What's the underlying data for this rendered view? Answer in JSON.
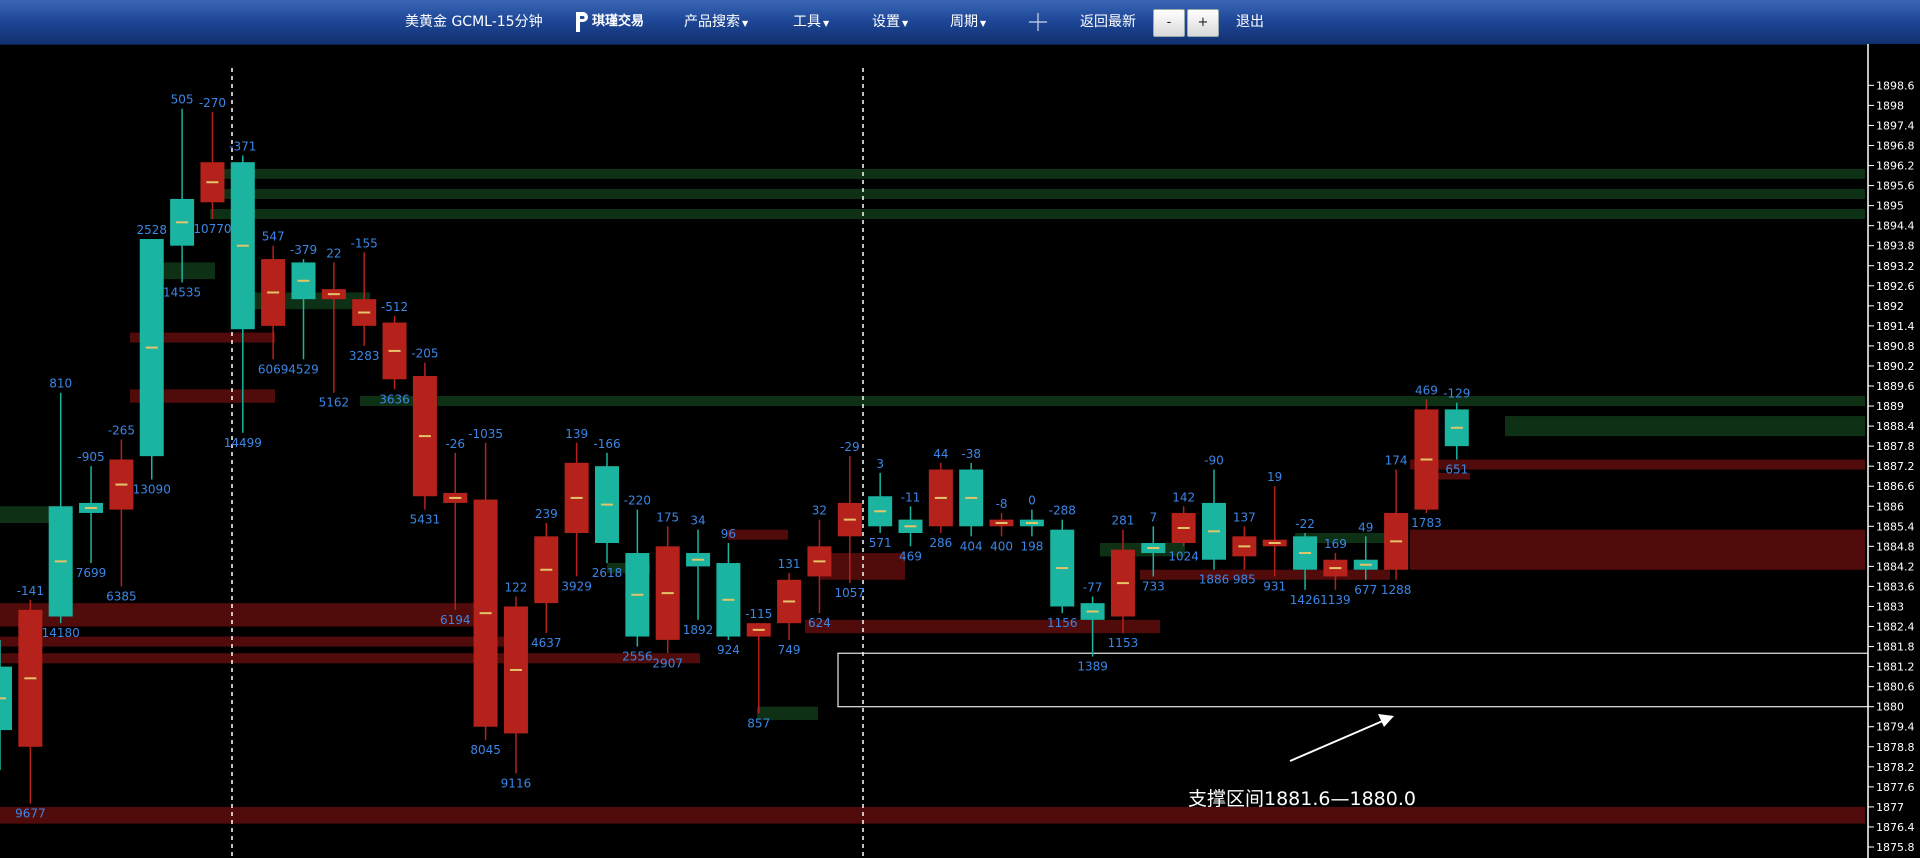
{
  "toolbar": {
    "title": "美黄金 GCML-15分钟",
    "logo_text": "琪瑾交易",
    "menus": [
      "产品搜索",
      "工具",
      "设置",
      "周期"
    ],
    "latest_label": "返回最新",
    "zoom_out": "-",
    "zoom_in": "+",
    "exit_label": "退出"
  },
  "chart_data": {
    "type": "candlestick",
    "y_range": [
      1875.8,
      1899.0
    ],
    "y_ticks": [
      1898.6,
      1898,
      1897.4,
      1896.8,
      1896.2,
      1895.6,
      1895,
      1894.4,
      1893.8,
      1893.2,
      1892.6,
      1892,
      1891.4,
      1890.8,
      1890.2,
      1889.6,
      1889,
      1888.4,
      1887.8,
      1887.2,
      1886.6,
      1886,
      1885.4,
      1884.8,
      1884.2,
      1883.6,
      1883,
      1882.4,
      1881.8,
      1881.2,
      1880.6,
      1880,
      1879.4,
      1878.8,
      1878.2,
      1877.6,
      1877,
      1876.4,
      1875.8
    ],
    "annotation": "支撑区间1881.6—1880.0",
    "support_zone": [
      1880.0,
      1881.6
    ],
    "colors": {
      "up": "#1ab4a0",
      "down": "#b5221c",
      "label": "#3a86e6",
      "avg": "#e3c46a"
    },
    "candles": [
      {
        "o": 1879.3,
        "h": 1882,
        "l": 1878.1,
        "c": 1881.2,
        "top": null,
        "bot": null
      },
      {
        "o": 1882.9,
        "h": 1883.2,
        "l": 1877.1,
        "c": 1878.8,
        "top": "-141",
        "bot": "9677"
      },
      {
        "o": 1882.7,
        "h": 1889.4,
        "l": 1882.5,
        "c": 1886.0,
        "top": "810",
        "bot": "14180"
      },
      {
        "o": 1885.8,
        "h": 1887.2,
        "l": 1884.3,
        "c": 1886.1,
        "top": "-905",
        "bot": "7699"
      },
      {
        "o": 1887.4,
        "h": 1888.0,
        "l": 1883.6,
        "c": 1885.9,
        "top": "-265",
        "bot": "6385"
      },
      {
        "o": 1887.5,
        "h": 1894.0,
        "l": 1886.8,
        "c": 1894.0,
        "top": "2528",
        "bot": "13090"
      },
      {
        "o": 1893.8,
        "h": 1897.9,
        "l": 1892.7,
        "c": 1895.2,
        "top": "505",
        "bot": "14535"
      },
      {
        "o": 1896.3,
        "h": 1897.8,
        "l": 1894.6,
        "c": 1895.1,
        "top": "-270",
        "bot": "10770"
      },
      {
        "o": 1891.3,
        "h": 1896.5,
        "l": 1888.2,
        "c": 1896.3,
        "top": "-371",
        "bot": "14499"
      },
      {
        "o": 1893.4,
        "h": 1893.8,
        "l": 1890.4,
        "c": 1891.4,
        "top": "547",
        "bot": "6069"
      },
      {
        "o": 1892.2,
        "h": 1893.4,
        "l": 1890.4,
        "c": 1893.3,
        "top": "-379",
        "bot": "4529"
      },
      {
        "o": 1892.5,
        "h": 1893.3,
        "l": 1889.4,
        "c": 1892.2,
        "top": "22",
        "bot": "5162"
      },
      {
        "o": 1892.2,
        "h": 1893.6,
        "l": 1890.8,
        "c": 1891.4,
        "top": "-155",
        "bot": "3283"
      },
      {
        "o": 1891.5,
        "h": 1891.7,
        "l": 1889.5,
        "c": 1889.8,
        "top": "-512",
        "bot": "3636"
      },
      {
        "o": 1889.9,
        "h": 1890.3,
        "l": 1885.9,
        "c": 1886.3,
        "top": "-205",
        "bot": "5431"
      },
      {
        "o": 1886.4,
        "h": 1887.6,
        "l": 1882.9,
        "c": 1886.1,
        "top": "-26",
        "bot": "6194"
      },
      {
        "o": 1886.2,
        "h": 1887.9,
        "l": 1879.0,
        "c": 1879.4,
        "top": "-1035",
        "bot": "8045"
      },
      {
        "o": 1883.0,
        "h": 1883.3,
        "l": 1878.0,
        "c": 1879.2,
        "top": "122",
        "bot": "9116"
      },
      {
        "o": 1885.1,
        "h": 1885.5,
        "l": 1882.2,
        "c": 1883.1,
        "top": "239",
        "bot": "4637"
      },
      {
        "o": 1887.3,
        "h": 1887.9,
        "l": 1883.9,
        "c": 1885.2,
        "top": "139",
        "bot": "3929"
      },
      {
        "o": 1884.9,
        "h": 1887.6,
        "l": 1884.3,
        "c": 1887.2,
        "top": "-166",
        "bot": "2618"
      },
      {
        "o": 1882.1,
        "h": 1885.9,
        "l": 1881.8,
        "c": 1884.6,
        "top": "-220",
        "bot": "2556"
      },
      {
        "o": 1884.8,
        "h": 1885.4,
        "l": 1881.6,
        "c": 1882.0,
        "top": "175",
        "bot": "2907"
      },
      {
        "o": 1884.2,
        "h": 1885.3,
        "l": 1882.6,
        "c": 1884.6,
        "top": "34",
        "bot": "1892"
      },
      {
        "o": 1882.1,
        "h": 1884.9,
        "l": 1882.0,
        "c": 1884.3,
        "top": "96",
        "bot": "924"
      },
      {
        "o": 1882.5,
        "h": 1882.5,
        "l": 1879.8,
        "c": 1882.1,
        "top": "-115",
        "bot": "857"
      },
      {
        "o": 1883.8,
        "h": 1884.0,
        "l": 1882.0,
        "c": 1882.5,
        "top": "131",
        "bot": "749"
      },
      {
        "o": 1884.8,
        "h": 1885.6,
        "l": 1882.8,
        "c": 1883.9,
        "top": "32",
        "bot": "624"
      },
      {
        "o": 1886.1,
        "h": 1887.5,
        "l": 1883.7,
        "c": 1885.1,
        "top": "-29",
        "bot": "1057"
      },
      {
        "o": 1885.4,
        "h": 1887.0,
        "l": 1885.2,
        "c": 1886.3,
        "top": "3",
        "bot": "571"
      },
      {
        "o": 1885.2,
        "h": 1886.0,
        "l": 1884.8,
        "c": 1885.6,
        "top": "-11",
        "bot": "469"
      },
      {
        "o": 1887.1,
        "h": 1887.3,
        "l": 1885.2,
        "c": 1885.4,
        "top": "44",
        "bot": "286"
      },
      {
        "o": 1885.4,
        "h": 1887.3,
        "l": 1885.1,
        "c": 1887.1,
        "top": "-38",
        "bot": "404"
      },
      {
        "o": 1885.6,
        "h": 1885.8,
        "l": 1885.1,
        "c": 1885.4,
        "top": "-8",
        "bot": "400"
      },
      {
        "o": 1885.4,
        "h": 1885.9,
        "l": 1885.1,
        "c": 1885.6,
        "top": "0",
        "bot": "198"
      },
      {
        "o": 1883.0,
        "h": 1885.6,
        "l": 1882.8,
        "c": 1885.3,
        "top": "-288",
        "bot": "1156"
      },
      {
        "o": 1882.6,
        "h": 1883.3,
        "l": 1881.5,
        "c": 1883.1,
        "top": "-77",
        "bot": "1389"
      },
      {
        "o": 1884.7,
        "h": 1885.3,
        "l": 1882.2,
        "c": 1882.7,
        "top": "281",
        "bot": "1153"
      },
      {
        "o": 1884.6,
        "h": 1885.4,
        "l": 1883.9,
        "c": 1884.9,
        "top": "7",
        "bot": "733"
      },
      {
        "o": 1885.8,
        "h": 1886.0,
        "l": 1884.8,
        "c": 1884.9,
        "top": "142",
        "bot": "1024"
      },
      {
        "o": 1884.4,
        "h": 1887.1,
        "l": 1884.1,
        "c": 1886.1,
        "top": "-90",
        "bot": "1886"
      },
      {
        "o": 1885.1,
        "h": 1885.4,
        "l": 1884.1,
        "c": 1884.5,
        "top": "137",
        "bot": "985"
      },
      {
        "o": 1885.0,
        "h": 1886.6,
        "l": 1883.9,
        "c": 1884.8,
        "top": "19",
        "bot": "931"
      },
      {
        "o": 1884.1,
        "h": 1885.2,
        "l": 1883.5,
        "c": 1885.1,
        "top": "-22",
        "bot": "1426"
      },
      {
        "o": 1884.4,
        "h": 1884.6,
        "l": 1883.5,
        "c": 1883.9,
        "top": "169",
        "bot": "1139"
      },
      {
        "o": 1884.1,
        "h": 1885.1,
        "l": 1883.8,
        "c": 1884.4,
        "top": "49",
        "bot": "677"
      },
      {
        "o": 1885.8,
        "h": 1887.1,
        "l": 1883.8,
        "c": 1884.1,
        "top": "174",
        "bot": "1288"
      },
      {
        "o": 1888.9,
        "h": 1889.2,
        "l": 1885.8,
        "c": 1885.9,
        "top": "469",
        "bot": "1783"
      },
      {
        "o": 1887.8,
        "h": 1889.1,
        "l": 1887.4,
        "c": 1888.9,
        "top": "-129",
        "bot": "651"
      }
    ],
    "zones": [
      {
        "y1": 1896.1,
        "y2": 1895.8,
        "x1": 210,
        "x2": 1865,
        "c": "g"
      },
      {
        "y1": 1895.5,
        "y2": 1895.2,
        "x1": 210,
        "x2": 1865,
        "c": "g"
      },
      {
        "y1": 1894.9,
        "y2": 1894.6,
        "x1": 210,
        "x2": 1865,
        "c": "g"
      },
      {
        "y1": 1889.3,
        "y2": 1889.0,
        "x1": 360,
        "x2": 1865,
        "c": "g"
      },
      {
        "y1": 1888.7,
        "y2": 1888.1,
        "x1": 1505,
        "x2": 1865,
        "c": "g"
      },
      {
        "y1": 1893.3,
        "y2": 1892.8,
        "x1": 158,
        "x2": 215,
        "c": "g"
      },
      {
        "y1": 1892.4,
        "y2": 1891.9,
        "x1": 250,
        "x2": 370,
        "c": "g"
      },
      {
        "y1": 1886.0,
        "y2": 1885.5,
        "x1": 0,
        "x2": 60,
        "c": "g"
      },
      {
        "y1": 1884.9,
        "y2": 1884.5,
        "x1": 1100,
        "x2": 1185,
        "c": "g"
      },
      {
        "y1": 1885.2,
        "y2": 1884.9,
        "x1": 1295,
        "x2": 1390,
        "c": "g"
      },
      {
        "y1": 1884.3,
        "y2": 1884.0,
        "x1": 607,
        "x2": 650,
        "c": "g"
      },
      {
        "y1": 1880.0,
        "y2": 1879.6,
        "x1": 757,
        "x2": 818,
        "c": "g"
      },
      {
        "y1": 1891.2,
        "y2": 1890.9,
        "x1": 130,
        "x2": 275,
        "c": "r"
      },
      {
        "y1": 1889.5,
        "y2": 1889.1,
        "x1": 130,
        "x2": 275,
        "c": "r"
      },
      {
        "y1": 1887.4,
        "y2": 1887.1,
        "x1": 1410,
        "x2": 1865,
        "c": "r"
      },
      {
        "y1": 1887.0,
        "y2": 1886.8,
        "x1": 1415,
        "x2": 1470,
        "c": "r"
      },
      {
        "y1": 1885.3,
        "y2": 1884.6,
        "x1": 1410,
        "x2": 1865,
        "c": "r"
      },
      {
        "y1": 1884.6,
        "y2": 1884.1,
        "x1": 1410,
        "x2": 1865,
        "c": "r"
      },
      {
        "y1": 1884.6,
        "y2": 1883.8,
        "x1": 820,
        "x2": 905,
        "c": "r"
      },
      {
        "y1": 1885.3,
        "y2": 1885.0,
        "x1": 728,
        "x2": 788,
        "c": "r"
      },
      {
        "y1": 1884.1,
        "y2": 1883.8,
        "x1": 1140,
        "x2": 1390,
        "c": "r"
      },
      {
        "y1": 1883.1,
        "y2": 1882.4,
        "x1": 0,
        "x2": 480,
        "c": "r"
      },
      {
        "y1": 1882.6,
        "y2": 1882.2,
        "x1": 805,
        "x2": 1160,
        "c": "r"
      },
      {
        "y1": 1882.1,
        "y2": 1881.8,
        "x1": 0,
        "x2": 525,
        "c": "r"
      },
      {
        "y1": 1881.6,
        "y2": 1881.3,
        "x1": 0,
        "x2": 700,
        "c": "r"
      },
      {
        "y1": 1877.0,
        "y2": 1876.5,
        "x1": 0,
        "x2": 1865,
        "c": "r"
      }
    ]
  }
}
